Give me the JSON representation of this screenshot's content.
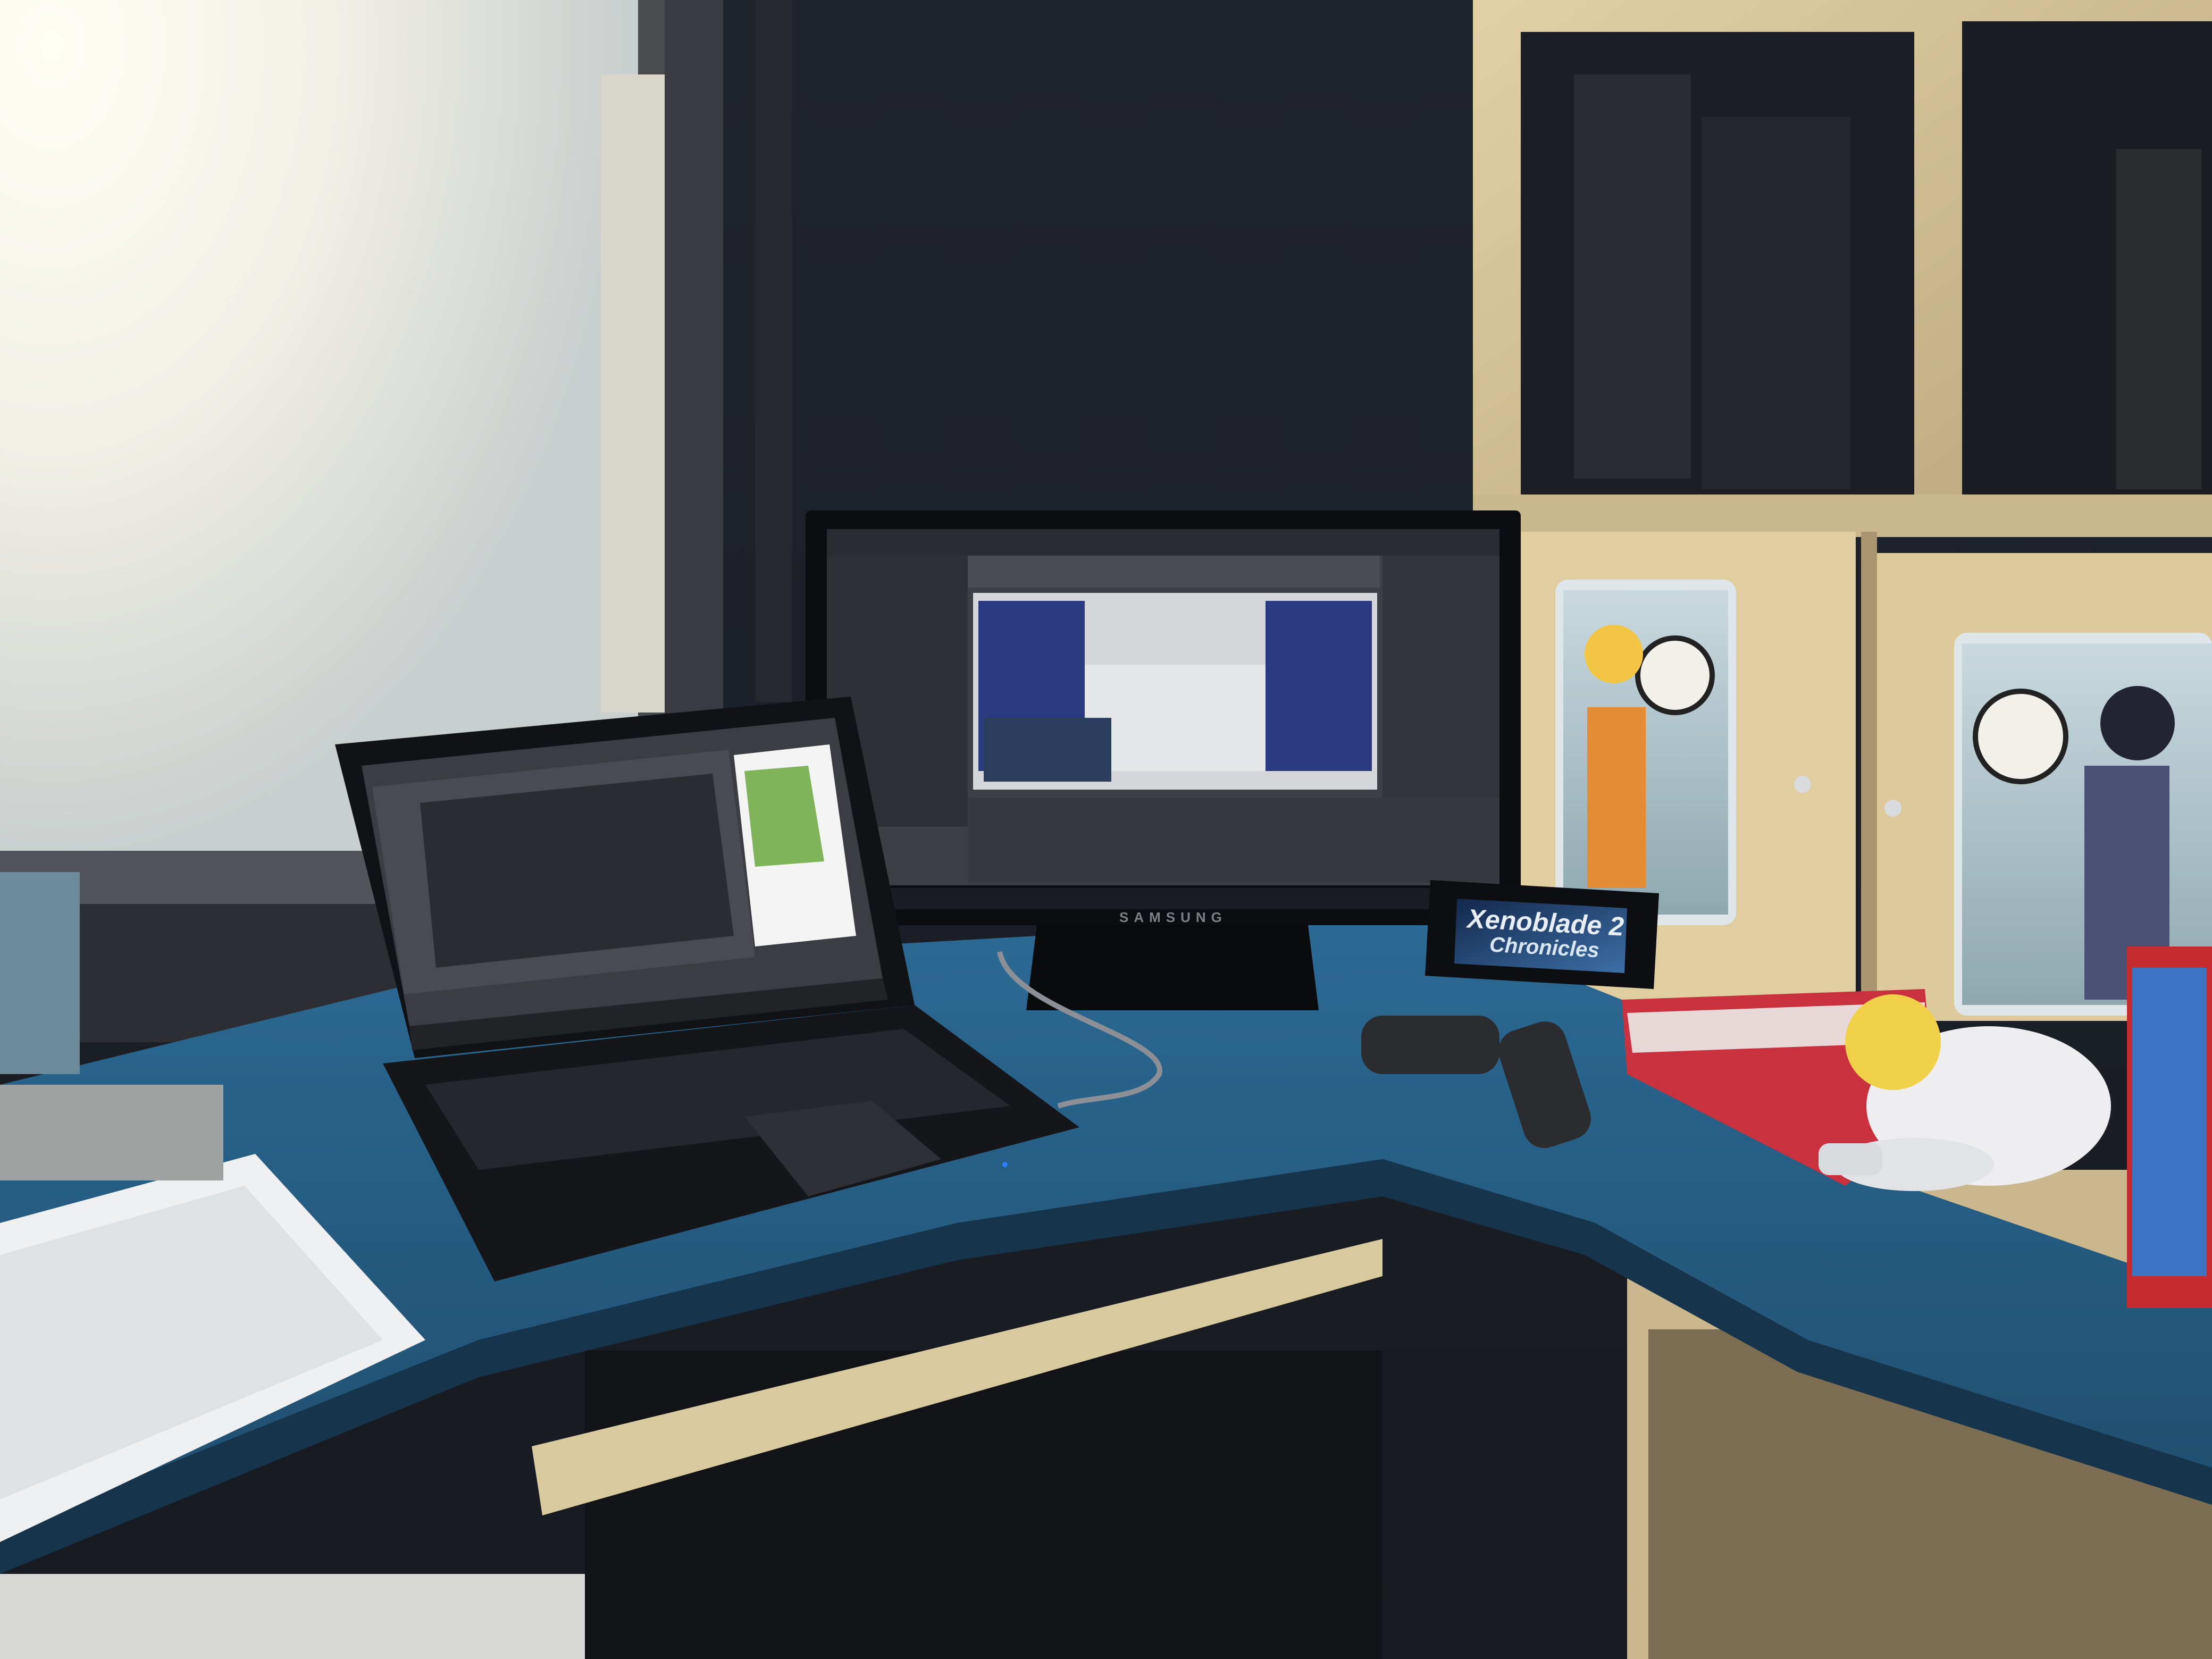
{
  "scene": {
    "title": "Home desk setup with laptop, Samsung monitor and Nintendo Switch",
    "description": "A corner desk with a blue top near a bright window. A laptop shows a 3D editor, a Samsung monitor shows a game engine editor, and a Nintendo Switch stands next to it.",
    "colors": {
      "wall": "#1b1d24",
      "desk": "#2a5f86",
      "shelf_wood": "#d8c69a",
      "window_light": "#f6f5ee"
    }
  },
  "monitor": {
    "brand": "SAMSUNG"
  },
  "switch_console": {
    "game_title": "Xenoblade 2",
    "game_subtitle": "Chronicles"
  }
}
